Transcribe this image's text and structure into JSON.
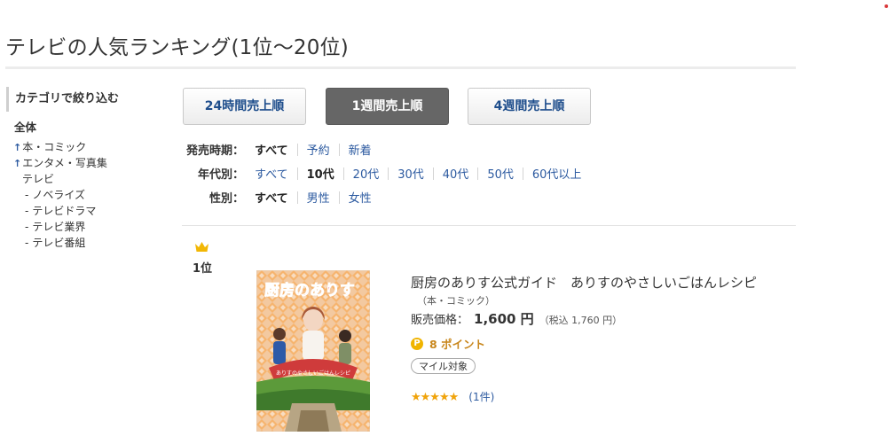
{
  "page_title": "テレビの人気ランキング(1位〜20位)",
  "sidebar": {
    "heading": "カテゴリで絞り込む",
    "items": [
      {
        "label": "全体",
        "prefix": ""
      },
      {
        "label": "本・コミック",
        "prefix": "↑"
      },
      {
        "label": "エンタメ・写真集",
        "prefix": "↑"
      },
      {
        "label": "テレビ",
        "prefix": ""
      },
      {
        "label": "ノベライズ",
        "prefix": "-"
      },
      {
        "label": "テレビドラマ",
        "prefix": "-"
      },
      {
        "label": "テレビ業界",
        "prefix": "-"
      },
      {
        "label": "テレビ番組",
        "prefix": "-"
      }
    ]
  },
  "sort_tabs": [
    {
      "label": "24時間売上順",
      "active": false
    },
    {
      "label": "1週間売上順",
      "active": true
    },
    {
      "label": "4週間売上順",
      "active": false
    }
  ],
  "filters": {
    "release": {
      "label": "発売時期：",
      "options": [
        "すべて",
        "予約",
        "新着"
      ],
      "selected": "すべて"
    },
    "age": {
      "label": "年代別：",
      "options": [
        "すべて",
        "10代",
        "20代",
        "30代",
        "40代",
        "50代",
        "60代以上"
      ],
      "selected": "10代"
    },
    "gender": {
      "label": "性別：",
      "options": [
        "すべて",
        "男性",
        "女性"
      ],
      "selected": "すべて"
    }
  },
  "ranking_item": {
    "rank": "1位",
    "title": "厨房のありす公式ガイド　ありすのやさしいごはんレシピ",
    "category": "（本・コミック）",
    "price_label": "販売価格：",
    "price": "1,600 円",
    "price_tax": "（税込 1,760 円）",
    "points": "8 ポイント",
    "point_icon_char": "P",
    "mile_badge": "マイル対象",
    "stars": "★★★★★",
    "rating": 5,
    "reviews": "(1件)",
    "cover_title": "厨房のありす",
    "cover_subtitle": "ありすのやさしいごはんレシピ"
  },
  "colors": {
    "link": "#2c5aa0",
    "active_tab": "#666666",
    "points": "#c8861b",
    "star": "#f0a30a",
    "crown": "#f2b705"
  },
  "icons": {
    "crown": "crown-icon",
    "point": "point-icon",
    "up_arrow": "up-arrow-icon"
  }
}
